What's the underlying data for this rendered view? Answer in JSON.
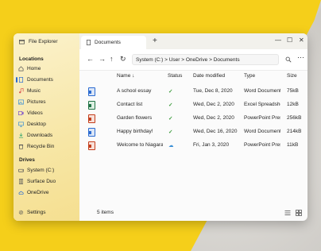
{
  "sidebar": {
    "app_title": "File Explorer",
    "locations_heading": "Locations",
    "locations": [
      {
        "label": "Home",
        "icon": "home-icon",
        "color": "#666666"
      },
      {
        "label": "Documents",
        "icon": "document-icon",
        "color": "#2b6bd1"
      },
      {
        "label": "Music",
        "icon": "music-icon",
        "color": "#d9534f"
      },
      {
        "label": "Pictures",
        "icon": "picture-icon",
        "color": "#3a8fd6"
      },
      {
        "label": "Videos",
        "icon": "video-icon",
        "color": "#7a4fc9"
      },
      {
        "label": "Desktop",
        "icon": "desktop-icon",
        "color": "#3a8fd6"
      },
      {
        "label": "Downloads",
        "icon": "download-icon",
        "color": "#2ba36a"
      },
      {
        "label": "Recycle Bin",
        "icon": "recycle-bin-icon",
        "color": "#666666"
      }
    ],
    "drives_heading": "Drives",
    "drives": [
      {
        "label": "System (C:)",
        "icon": "drive-icon"
      },
      {
        "label": "Surface Duo",
        "icon": "phone-icon"
      },
      {
        "label": "OneDrive",
        "icon": "cloud-icon"
      }
    ],
    "settings_label": "Settings"
  },
  "tabs": {
    "active_tab": "Documents",
    "new_tab_symbol": "+"
  },
  "window_controls": {
    "minimize": "—",
    "maximize": "☐",
    "close": "✕"
  },
  "address": {
    "path": "System (C:) > User > OneDrive > Documents"
  },
  "columns": {
    "name": "Name",
    "sort_arrow": "↓",
    "status": "Status",
    "date": "Date modified",
    "type": "Type",
    "size": "Size"
  },
  "files": [
    {
      "name": "A school essay",
      "status": "✓",
      "date": "Tue, Dec 8, 2020",
      "type": "Word Document",
      "size": "75kB",
      "icon_color": "#2b6bd1"
    },
    {
      "name": "Contact list",
      "status": "✓",
      "date": "Wed, Dec 2, 2020",
      "type": "Excel Spreadsheet",
      "size": "12kB",
      "icon_color": "#217346"
    },
    {
      "name": "Garden flowers",
      "status": "✓",
      "date": "Wed, Dec 2, 2020",
      "type": "PowerPoint Presentation",
      "size": "256kB",
      "icon_color": "#c43e1c"
    },
    {
      "name": "Happy birthday!",
      "status": "✓",
      "date": "Wed, Dec 16, 2020",
      "type": "Word Document",
      "size": "214kB",
      "icon_color": "#2b6bd1"
    },
    {
      "name": "Welcome to Niagara",
      "status": "☁",
      "date": "Fri, Jan 3, 2020",
      "type": "PowerPoint Presentation",
      "size": "11kB",
      "icon_color": "#c43e1c"
    }
  ],
  "statusbar": {
    "count": "5 items"
  }
}
